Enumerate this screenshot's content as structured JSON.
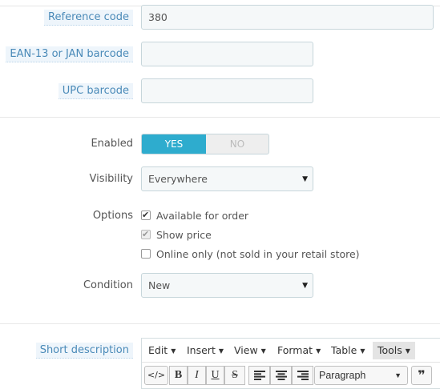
{
  "fields": {
    "reference_code": {
      "label": "Reference code",
      "value": "380"
    },
    "ean13": {
      "label": "EAN-13 or JAN barcode",
      "value": ""
    },
    "upc": {
      "label": "UPC barcode",
      "value": ""
    }
  },
  "enabled": {
    "label": "Enabled",
    "yes": "YES",
    "no": "NO",
    "selected": "YES"
  },
  "visibility": {
    "label": "Visibility",
    "value": "Everywhere"
  },
  "options": {
    "label": "Options",
    "available_for_order": {
      "label": "Available for order",
      "checked": true
    },
    "show_price": {
      "label": "Show price",
      "checked": true,
      "disabled": true
    },
    "online_only": {
      "label": "Online only (not sold in your retail store)",
      "checked": false
    }
  },
  "condition": {
    "label": "Condition",
    "value": "New"
  },
  "short_description": {
    "label": "Short description",
    "menus": [
      "Edit",
      "Insert",
      "View",
      "Format",
      "Table",
      "Tools"
    ],
    "active_menu": "Tools",
    "toolbar": {
      "source_code_icon": "</>",
      "bold_icon": "B",
      "italic_icon": "I",
      "underline_icon": "U",
      "strikethrough_icon": "S",
      "align_left_icon": "align-left",
      "align_center_icon": "align-center",
      "align_right_icon": "align-right",
      "format_select": "Paragraph",
      "blockquote_icon": "❞"
    }
  },
  "colors": {
    "accent": "#2eacce",
    "label_highlight": "#4a8ab8"
  }
}
